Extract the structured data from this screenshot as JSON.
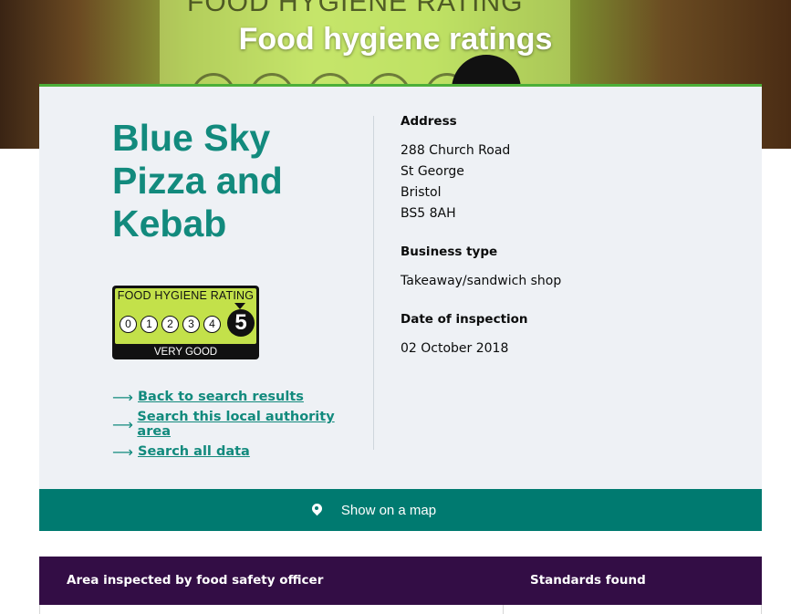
{
  "hero": {
    "title": "Food hygiene ratings",
    "sign_text": "FOOD HYGIENE RATING"
  },
  "business": {
    "name_lines": [
      "Blue Sky",
      "Pizza and",
      "Kebab"
    ]
  },
  "rating_badge": {
    "header": "FOOD HYGIENE RATING",
    "scale": [
      "0",
      "1",
      "2",
      "3",
      "4"
    ],
    "score": "5",
    "label": "VERY GOOD"
  },
  "links": [
    {
      "label": "Back to search results"
    },
    {
      "label": "Search this local authority area"
    },
    {
      "label": "Search all data"
    }
  ],
  "details": {
    "address_heading": "Address",
    "address_lines": [
      "288 Church Road",
      "St George",
      "Bristol",
      "BS5 8AH"
    ],
    "business_type_heading": "Business type",
    "business_type": "Takeaway/sandwich shop",
    "inspection_heading": "Date of inspection",
    "inspection_date": "02 October 2018"
  },
  "map_button": {
    "label": "Show on a map",
    "icon": "map-pin-icon"
  },
  "table": {
    "col1_header": "Area inspected by food safety officer",
    "col2_header": "Standards found"
  },
  "colors": {
    "teal_text": "#128a7d",
    "map_bar": "#007a70",
    "table_header": "#330d45",
    "card_bg": "#eef1f5",
    "accent_green": "#4caf39",
    "badge_green": "#c3e14a"
  }
}
